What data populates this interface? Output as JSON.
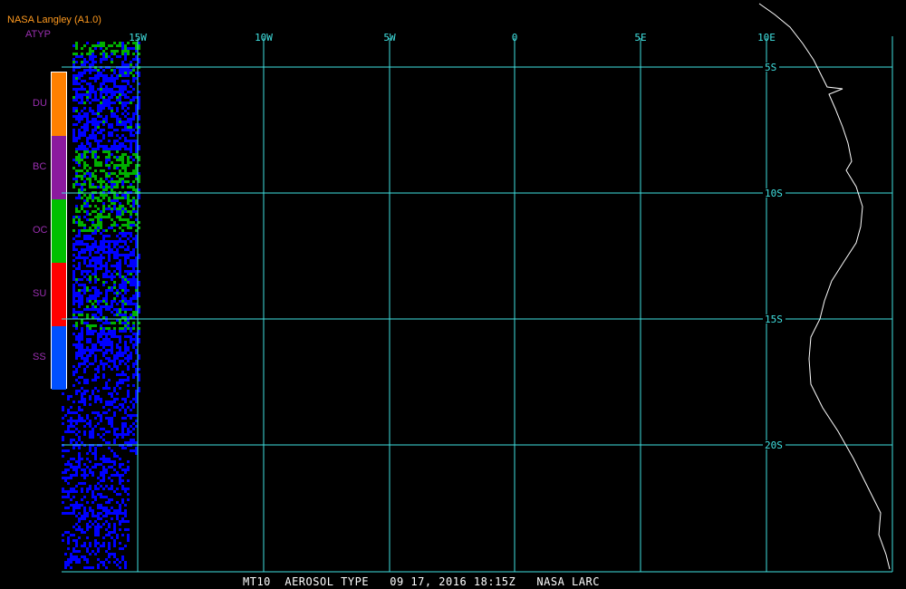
{
  "header": {
    "title": "NASA Langley (A1.0)",
    "layer": "ATYP"
  },
  "legend": {
    "items": [
      {
        "label": "DU",
        "color": "#ff8000"
      },
      {
        "label": "BC",
        "color": "#8b1a9e"
      },
      {
        "label": "OC",
        "color": "#00c000"
      },
      {
        "label": "SU",
        "color": "#ff0000"
      },
      {
        "label": "SS",
        "color": "#0050ff"
      }
    ]
  },
  "map": {
    "lon_labels": [
      "15W",
      "10W",
      "5W",
      "0",
      "5E",
      "10E"
    ],
    "lat_labels": [
      "5S",
      "10S",
      "15S",
      "20S"
    ],
    "grid_color": "#40e0e0",
    "coast_color": "#ffffff",
    "aerosol_colors": {
      "ocean": "#0000ff",
      "organic": "#00b000"
    }
  },
  "footer": "MT10  AEROSOL TYPE   09 17, 2016 18:15Z   NASA LARC"
}
